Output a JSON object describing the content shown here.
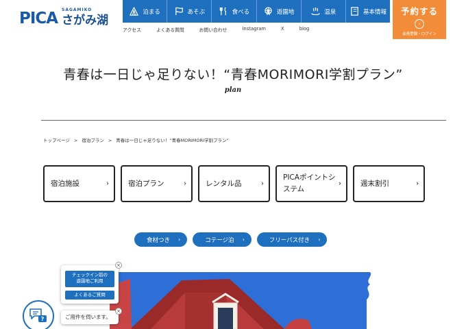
{
  "header": {
    "logo_mark": "PICA",
    "logo_sub": "SAGAMIKO",
    "logo_name": "さがみ湖",
    "nav": [
      {
        "label": "泊まる",
        "icon": "tent-icon"
      },
      {
        "label": "あそぶ",
        "icon": "flag-icon"
      },
      {
        "label": "食べる",
        "icon": "fork-knife-icon"
      },
      {
        "label": "遊園地",
        "icon": "ferris-wheel-icon"
      },
      {
        "label": "温泉",
        "icon": "hot-spring-icon"
      },
      {
        "label": "基本情報",
        "icon": "book-icon"
      }
    ],
    "subnav": [
      "アクセス",
      "よくある質問",
      "お問い合わせ",
      "Instagram",
      "X",
      "blog"
    ],
    "reserve": {
      "label": "予約する",
      "sub": "会員登録・ログイン",
      "color": "#f28c38"
    }
  },
  "page": {
    "title": "青春は一日じゃ足りない！“青春MORIMORI学割プラン”",
    "subtitle": "plan",
    "breadcrumb": [
      "トップページ",
      "宿泊プラン",
      "青春は一日じゃ足りない！“青春MORIMORI学割プラン”"
    ],
    "breadcrumb_sep": ">"
  },
  "cards": [
    {
      "label": "宿泊施設"
    },
    {
      "label": "宿泊プラン"
    },
    {
      "label": "レンタル品"
    },
    {
      "label": "PICAポイントシステム"
    },
    {
      "label": "週末割引"
    }
  ],
  "pills": [
    {
      "label": "食材つき"
    },
    {
      "label": "コテージ泊"
    },
    {
      "label": "フリーパス付き"
    }
  ],
  "chat": {
    "btn1": "チェックイン前の\n遊園地ご利用",
    "btn2": "よくあるご質問",
    "bubble": "ご用件を伺います。",
    "close": "×"
  },
  "colors": {
    "brand_blue": "#1f6fbf",
    "accent_orange": "#f28c38"
  }
}
